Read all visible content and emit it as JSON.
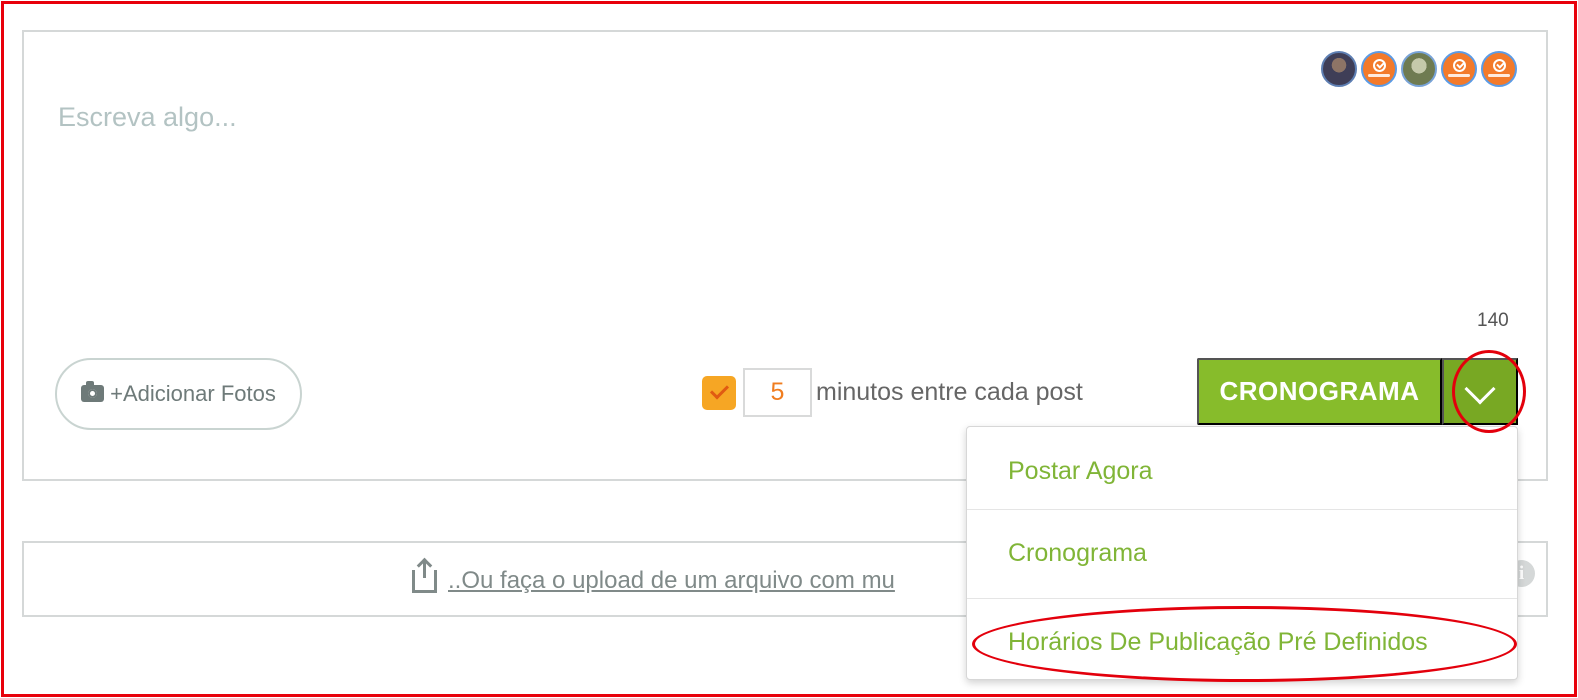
{
  "composer": {
    "placeholder": "Escreva algo...",
    "character_count": "140",
    "accounts": [
      {
        "icon": "profile-photo-avatar"
      },
      {
        "icon": "brand-logo-avatar"
      },
      {
        "icon": "profile-photo-avatar"
      },
      {
        "icon": "brand-logo-avatar"
      },
      {
        "icon": "brand-logo-avatar"
      }
    ]
  },
  "toolbar": {
    "add_photos_label": "+Adicionar Fotos",
    "interval_enabled": true,
    "minutes_value": "5",
    "minutes_label": "minutos entre cada post",
    "schedule_button_label": "CRONOGRAMA"
  },
  "upload": {
    "link_text": "..Ou faça o upload de um arquivo com mu",
    "info_label": "i"
  },
  "dropdown": {
    "items": [
      {
        "label": "Postar Agora"
      },
      {
        "label": "Cronograma"
      },
      {
        "label": "Horários De Publicação Pré Definidos"
      }
    ]
  },
  "colors": {
    "annotation_red": "#e3000c",
    "primary_green": "#87bc2b",
    "menu_green": "#80b537",
    "checkbox_orange": "#f6a624"
  }
}
